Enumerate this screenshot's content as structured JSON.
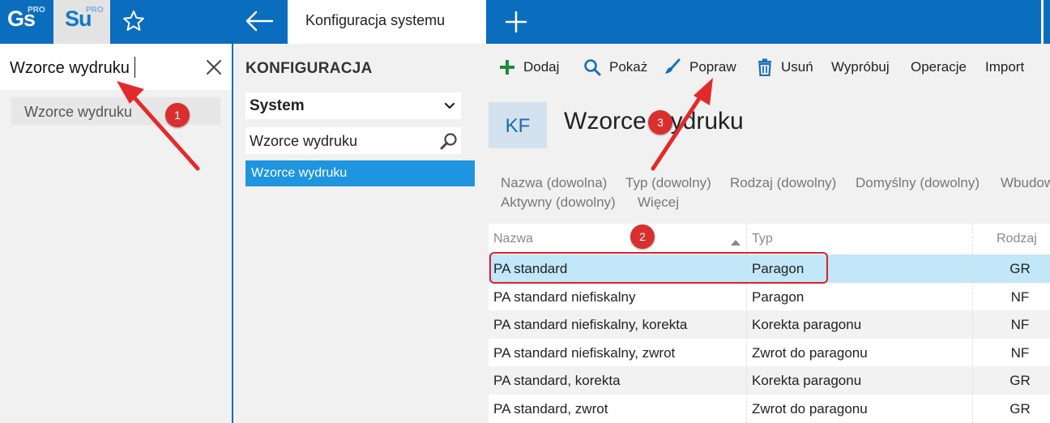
{
  "topbar": {
    "apps": [
      {
        "name": "Gs",
        "badge": "PRO"
      },
      {
        "name": "Su",
        "badge": "PRO"
      }
    ],
    "active_tab": "Konfiguracja systemu"
  },
  "search": {
    "value": "Wzorce wydruku",
    "results": [
      "Wzorce wydruku"
    ]
  },
  "config_panel": {
    "title": "KONFIGURACJA",
    "section_select": "System",
    "filter_value": "Wzorce wydruku",
    "items": [
      "Wzorce wydruku"
    ]
  },
  "toolbar": {
    "add": "Dodaj",
    "show": "Pokaż",
    "edit": "Popraw",
    "delete": "Usuń",
    "try": "Wypróbuj",
    "operations": "Operacje",
    "import": "Import"
  },
  "page": {
    "badge": "KF",
    "title": "Wzorce wydruku"
  },
  "filters": [
    "Nazwa (dowolna)",
    "Typ (dowolny)",
    "Rodzaj (dowolny)",
    "Domyślny (dowolny)",
    "Wbudowany",
    "Aktywny (dowolny)",
    "Więcej"
  ],
  "table": {
    "columns": [
      "Nazwa",
      "Typ",
      "Rodzaj"
    ],
    "rows": [
      {
        "name": "PA standard",
        "type": "Paragon",
        "kind": "GR"
      },
      {
        "name": "PA standard niefiskalny",
        "type": "Paragon",
        "kind": "NF"
      },
      {
        "name": "PA standard niefiskalny, korekta",
        "type": "Korekta paragonu",
        "kind": "NF"
      },
      {
        "name": "PA standard niefiskalny, zwrot",
        "type": "Zwrot do paragonu",
        "kind": "NF"
      },
      {
        "name": "PA standard, korekta",
        "type": "Korekta paragonu",
        "kind": "GR"
      },
      {
        "name": "PA standard, zwrot",
        "type": "Zwrot do paragonu",
        "kind": "GR"
      }
    ]
  },
  "annotations": {
    "step1": "1",
    "step2": "2",
    "step3": "3"
  },
  "colors": {
    "brand": "#0a6dbd",
    "selected_item": "#1e95de",
    "selected_row": "#c1e7f8",
    "annotation": "#d9302e",
    "add_icon": "#1e8a3a"
  }
}
